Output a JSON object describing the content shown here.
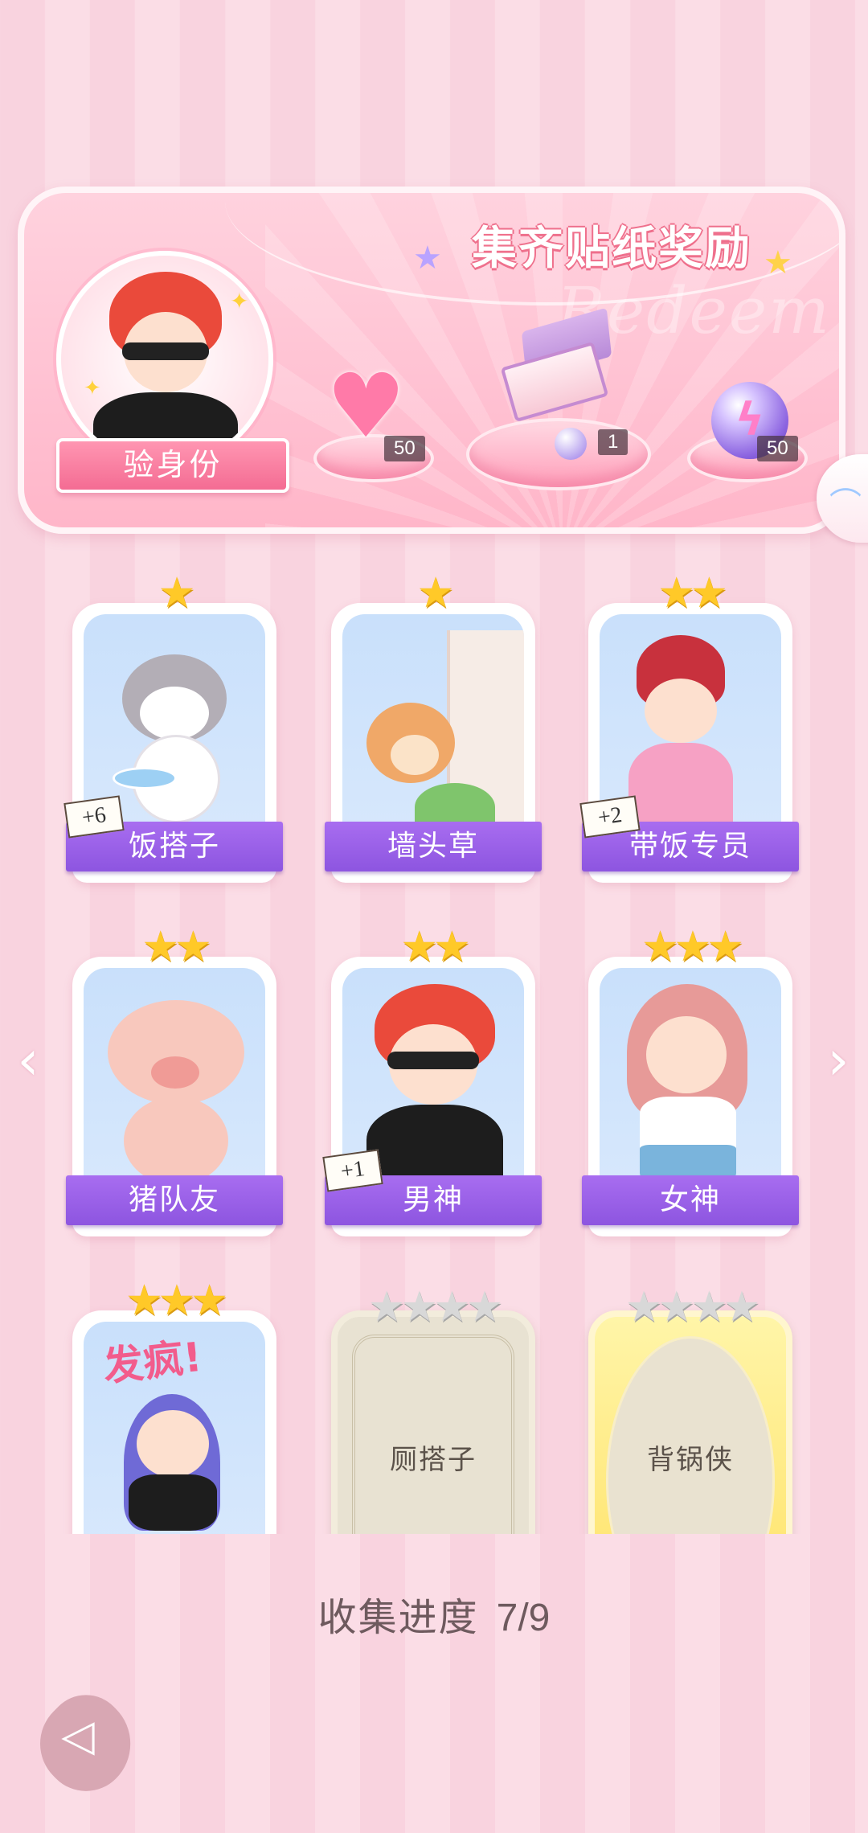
{
  "banner": {
    "title": "集齐贴纸奖励",
    "watermark": "Redeem",
    "verify_label": "验身份",
    "rewards": [
      {
        "icon": "pink-heart-gem-icon",
        "count": "50"
      },
      {
        "icon": "gift-box-icon",
        "count": "1"
      },
      {
        "icon": "purple-lightning-orb-icon",
        "count": "50"
      }
    ]
  },
  "stickers": [
    {
      "name": "饭搭子",
      "stars": "★",
      "plus": "+6",
      "collected": true
    },
    {
      "name": "墙头草",
      "stars": "★",
      "plus": "",
      "collected": true
    },
    {
      "name": "带饭专员",
      "stars": "★★",
      "plus": "+2",
      "collected": true
    },
    {
      "name": "猪队友",
      "stars": "★★",
      "plus": "",
      "collected": true
    },
    {
      "name": "男神",
      "stars": "★★",
      "plus": "+1",
      "collected": true
    },
    {
      "name": "女神",
      "stars": "★★★",
      "plus": "",
      "collected": true
    },
    {
      "name": "",
      "stars": "★★★",
      "plus": "",
      "collected": true,
      "art_text": "发疯!"
    },
    {
      "name": "厕搭子",
      "stars": "★★★★",
      "plus": "",
      "collected": false
    },
    {
      "name": "背锅侠",
      "stars": "★★★★",
      "plus": "",
      "collected": false
    }
  ],
  "progress": {
    "label": "收集进度",
    "value": "7/9"
  },
  "nav": {
    "prev": "‹",
    "next": "›"
  },
  "back_glyph": "◁",
  "colors": {
    "label_purple": "#9b62ea",
    "star_gold": "#ffc928",
    "banner_pink": "#ffc1d2"
  }
}
